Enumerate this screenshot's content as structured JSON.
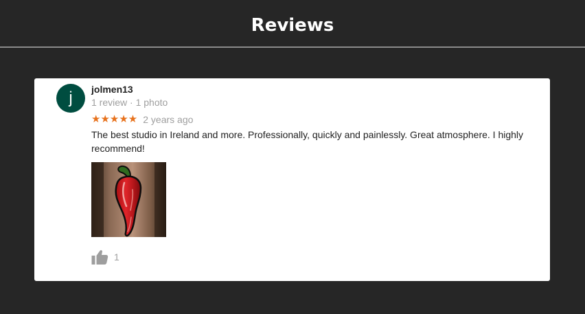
{
  "header": {
    "title": "Reviews"
  },
  "review": {
    "avatar_initial": "j",
    "avatar_color": "#004d40",
    "author": "jolmen13",
    "meta": "1 review · 1 photo",
    "stars": "★★★★★",
    "rating": 5,
    "star_color": "#e7711b",
    "date": "2 years ago",
    "text": "The best studio in Ireland and more. Professionally, quickly and painlessly. Great atmosphere. I  highly recommend!",
    "photo_icon": "chili-pepper-tattoo-photo",
    "like_icon": "thumbs-up-icon",
    "like_count": "1"
  }
}
